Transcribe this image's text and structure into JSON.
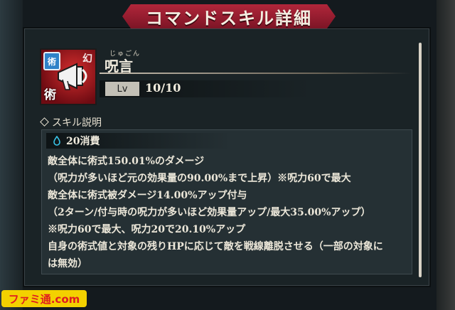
{
  "title": "コマンドスキル詳細",
  "skill": {
    "name": "呪言",
    "ruby": "じゅごん",
    "icon": "megaphone-icon",
    "badge_top": "術",
    "badge_gen": "幻",
    "badge_bottom": "術",
    "level_label": "Lv",
    "level_value": "10/10"
  },
  "section": {
    "label": "スキル説明"
  },
  "cost": {
    "icon": "orb-icon",
    "text": "20消費"
  },
  "description": [
    "敵全体に術式150.01%のダメージ",
    "（呪力が多いほど元の効果量の90.00%まで上昇）※呪力60で最大",
    "敵全体に術式被ダメージ14.00%アップ付与",
    "（2ターン/付与時の呪力が多いほど効果量アップ/最大35.00%アップ）",
    "※呪力60で最大、呪力20で20.10%アップ",
    "自身の術式値と対象の残りHPに応じて敵を戦線離脱させる（一部の対象に",
    "は無効）"
  ],
  "watermark": "ファミ通.com",
  "colors": {
    "banner": "#b1263a",
    "accent_blue": "#2f82c8",
    "icon_red": "#d42e2e"
  }
}
